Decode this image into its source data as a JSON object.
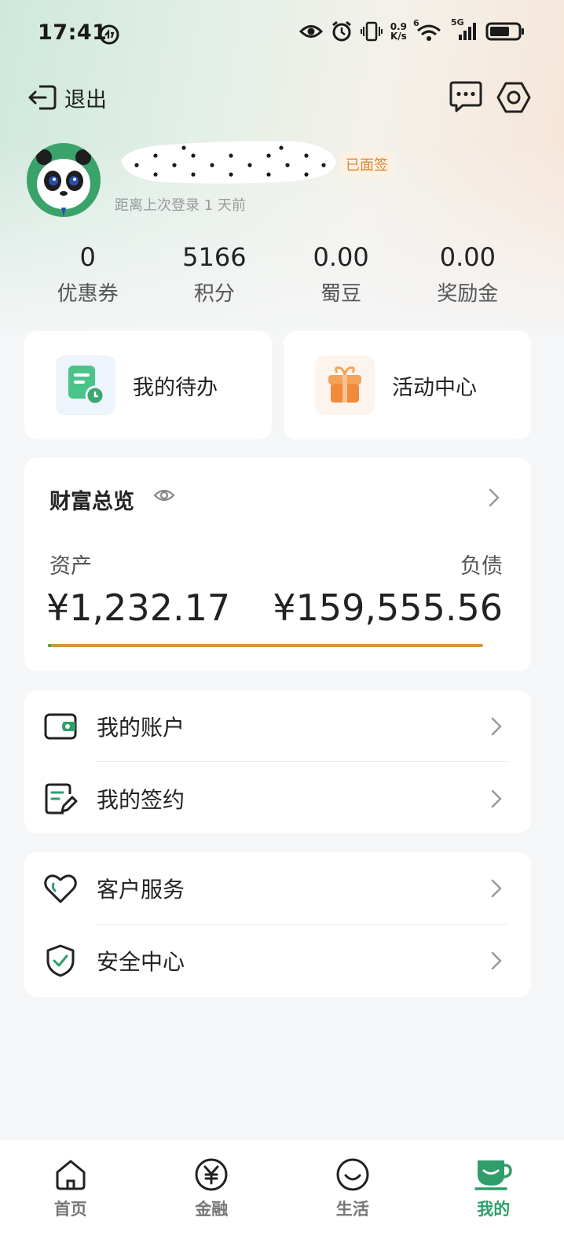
{
  "status_bar": {
    "time": "17:41",
    "net_speed_top": "0.9",
    "net_speed_bottom": "K/s",
    "signal_sim": "6",
    "network_type": "5G"
  },
  "header": {
    "exit_label": "退出"
  },
  "profile": {
    "face_verified_badge": "已面签",
    "last_login": "距离上次登录 1 天前"
  },
  "stats": [
    {
      "value": "0",
      "label": "优惠券"
    },
    {
      "value": "5166",
      "label": "积分"
    },
    {
      "value": "0.00",
      "label": "蜀豆"
    },
    {
      "value": "0.00",
      "label": "奖励金"
    }
  ],
  "quick_cards": {
    "todo": "我的待办",
    "activity": "活动中心"
  },
  "wealth": {
    "title": "财富总览",
    "asset_label": "资产",
    "debt_label": "负债",
    "asset_value": "¥1,232.17",
    "debt_value": "¥159,555.56",
    "asset_ratio": 0.0077
  },
  "menu_accounts": {
    "my_account": "我的账户",
    "my_signing": "我的签约"
  },
  "menu_service": {
    "customer_service": "客户服务",
    "security_center": "安全中心"
  },
  "tabs": [
    {
      "label": "首页",
      "icon": "home-icon"
    },
    {
      "label": "金融",
      "icon": "yuan-icon"
    },
    {
      "label": "生活",
      "icon": "smile-icon"
    },
    {
      "label": "我的",
      "icon": "cup-icon",
      "active": true
    }
  ],
  "colors": {
    "accent": "#2f9e6a",
    "badge_text": "#e0862e",
    "debt_bar": "#d49442"
  }
}
